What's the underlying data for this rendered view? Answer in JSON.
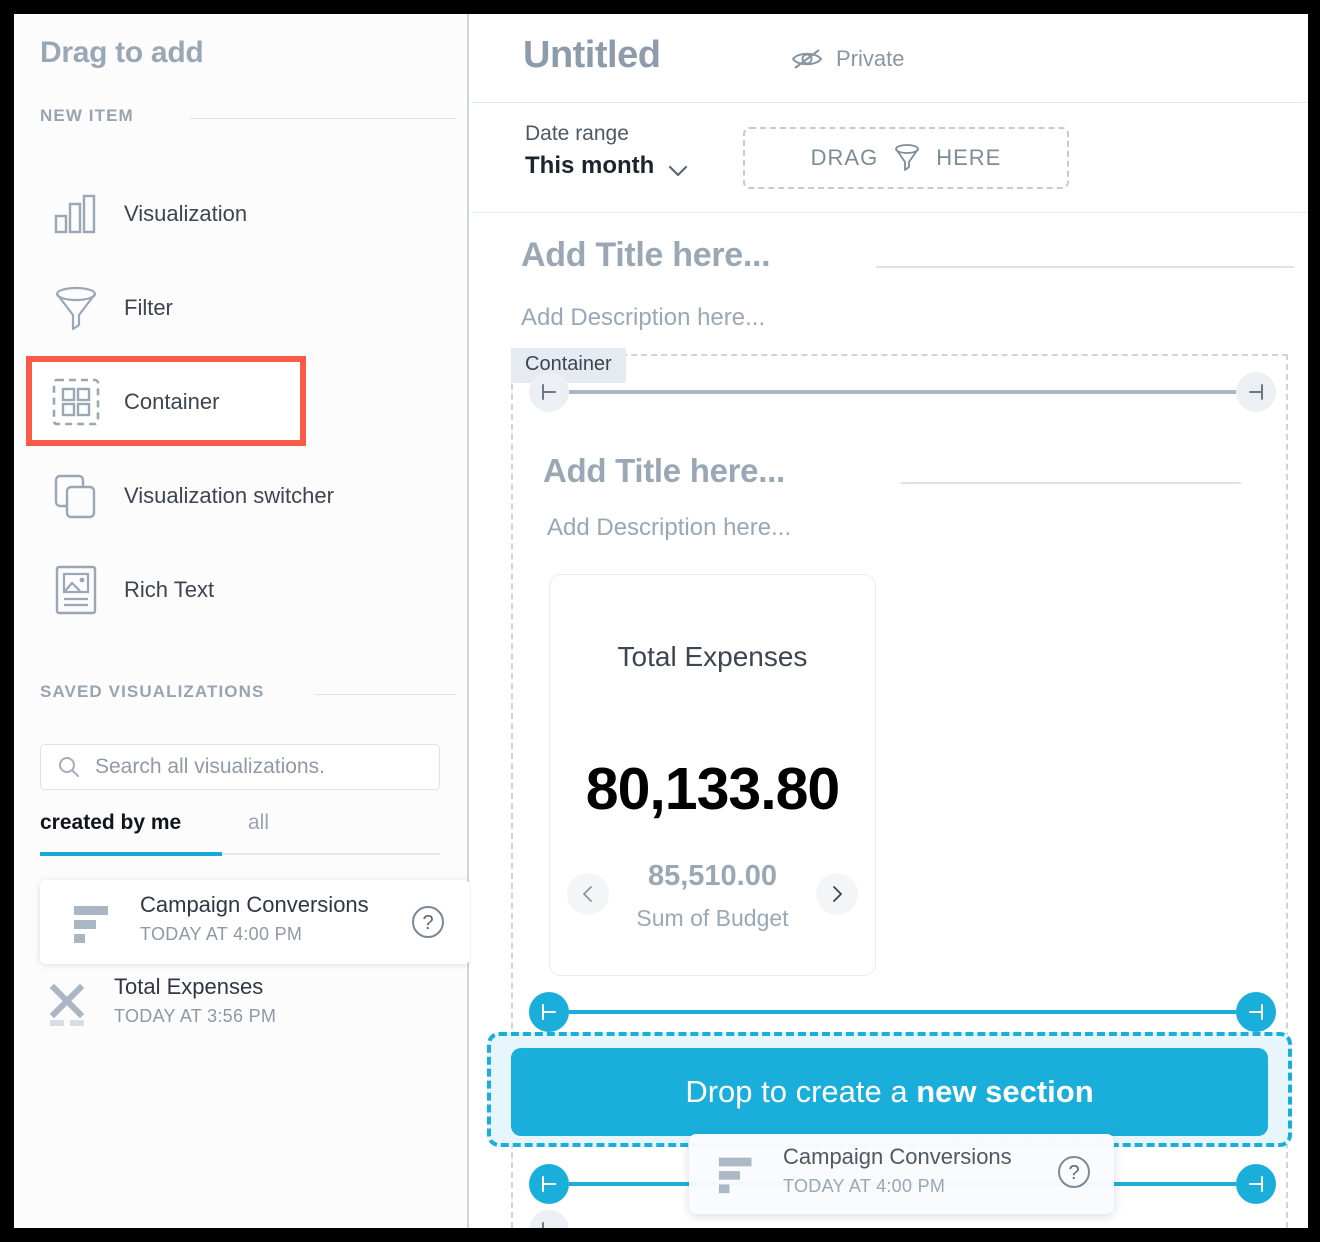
{
  "sidebar": {
    "title": "Drag to add",
    "new_item_heading": "NEW ITEM",
    "new_items": [
      {
        "label": "Visualization",
        "icon": "bar-chart-icon"
      },
      {
        "label": "Filter",
        "icon": "funnel-icon"
      },
      {
        "label": "Container",
        "icon": "container-grid-icon",
        "highlighted": true
      },
      {
        "label": "Visualization switcher",
        "icon": "stacked-cards-icon"
      },
      {
        "label": "Rich Text",
        "icon": "rich-text-icon"
      }
    ],
    "saved_heading": "SAVED VISUALIZATIONS",
    "search": {
      "placeholder": "Search all visualizations.",
      "value": "",
      "icon": "search-icon"
    },
    "tabs": [
      {
        "label": "created by me",
        "active": true
      },
      {
        "label": "all",
        "active": false
      }
    ],
    "saved_items": [
      {
        "name": "Campaign Conversions",
        "time": "TODAY AT 4:00 PM",
        "icon": "horizontal-bars-icon",
        "help": "?"
      },
      {
        "name": "Total Expenses",
        "time": "TODAY AT 3:56 PM",
        "icon": "kpi-x-icon"
      }
    ]
  },
  "header": {
    "title": "Untitled",
    "privacy_label": "Private",
    "privacy_icon": "eye-slash-icon"
  },
  "subbar": {
    "date_range_label": "Date range",
    "date_range_value": "This month",
    "caret_icon": "chevron-down-icon",
    "filter_drop": {
      "before": "DRAG",
      "after": "HERE",
      "icon": "funnel-icon"
    }
  },
  "page": {
    "title_placeholder": "Add Title here...",
    "description_placeholder": "Add Description here..."
  },
  "container": {
    "badge": "Container",
    "section": {
      "title_placeholder": "Add Title here...",
      "description_placeholder": "Add Description here..."
    }
  },
  "kpi_card": {
    "title": "Total Expenses",
    "value": "80,133.80",
    "secondary_value": "85,510.00",
    "secondary_label": "Sum of Budget",
    "prev_icon": "chevron-left-icon",
    "next_icon": "chevron-right-icon"
  },
  "dropzone": {
    "text_before": "Drop to create a ",
    "text_strong": "new section"
  },
  "drag_ghost": {
    "name": "Campaign Conversions",
    "time": "TODAY AT 4:00 PM",
    "icon": "horizontal-bars-icon",
    "help": "?"
  },
  "colors": {
    "accent_blue": "#1aaeda",
    "highlight_red": "#fa5b49",
    "muted_text": "#9aa7b5",
    "dropzone_bg": "#e7f6fc"
  }
}
